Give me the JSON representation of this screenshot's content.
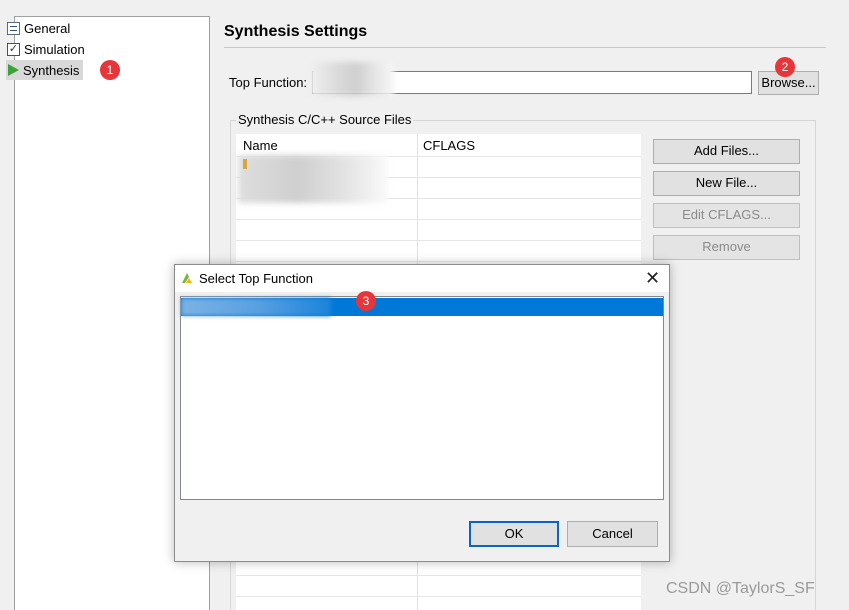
{
  "nav": {
    "items": [
      {
        "label": "General",
        "icon": "properties-icon"
      },
      {
        "label": "Simulation",
        "icon": "checkbox-icon"
      },
      {
        "label": "Synthesis",
        "icon": "play-icon"
      }
    ]
  },
  "badges": {
    "one": "1",
    "two": "2",
    "three": "3"
  },
  "settings": {
    "title": "Synthesis Settings",
    "top_function_label": "Top Function:",
    "top_function_value": "",
    "browse_label": "Browse..."
  },
  "sources": {
    "group_label": "Synthesis C/C++ Source Files",
    "columns": [
      "Name",
      "CFLAGS"
    ],
    "buttons": {
      "add_files": "Add Files...",
      "new_file": "New File...",
      "edit_cflags": "Edit CFLAGS...",
      "remove": "Remove"
    }
  },
  "dialog": {
    "title": "Select Top Function",
    "ok_label": "OK",
    "cancel_label": "Cancel"
  },
  "watermark": "CSDN @TaylorS_SF",
  "colors": {
    "selection": "#0078d7",
    "badge": "#e8353a",
    "run_icon": "#3aa23a"
  }
}
